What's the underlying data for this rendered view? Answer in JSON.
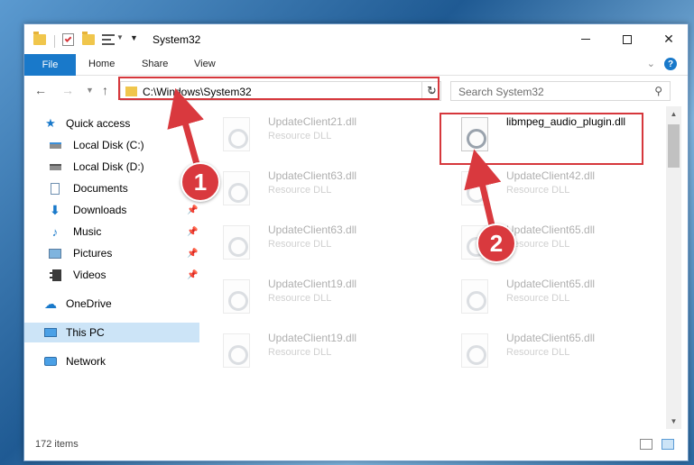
{
  "window": {
    "title": "System32"
  },
  "ribbon": {
    "tabs": [
      "File",
      "Home",
      "Share",
      "View"
    ]
  },
  "address": {
    "path": "C:\\Windows\\System32",
    "search_placeholder": "Search System32"
  },
  "sidebar": {
    "items": [
      {
        "label": "Quick access",
        "icon": "star-icon"
      },
      {
        "label": "Local Disk (C:)",
        "icon": "drive-icon"
      },
      {
        "label": "Local Disk (D:)",
        "icon": "drive-icon"
      },
      {
        "label": "Documents",
        "icon": "documents-icon"
      },
      {
        "label": "Downloads",
        "icon": "download-icon"
      },
      {
        "label": "Music",
        "icon": "music-icon"
      },
      {
        "label": "Pictures",
        "icon": "pictures-icon"
      },
      {
        "label": "Videos",
        "icon": "videos-icon"
      },
      {
        "label": "OneDrive",
        "icon": "cloud-icon"
      },
      {
        "label": "This PC",
        "icon": "computer-icon"
      },
      {
        "label": "Network",
        "icon": "network-icon"
      }
    ]
  },
  "files": [
    {
      "name": "UpdateClient21.dll",
      "type": "Resource DLL"
    },
    {
      "name": "libmpeg_audio_plugin.dll",
      "type": ""
    },
    {
      "name": "UpdateClient63.dll",
      "type": "Resource DLL"
    },
    {
      "name": "UpdateClient42.dll",
      "type": "Resource DLL"
    },
    {
      "name": "UpdateClient63.dll",
      "type": "Resource DLL"
    },
    {
      "name": "UpdateClient65.dll",
      "type": "Resource DLL"
    },
    {
      "name": "UpdateClient19.dll",
      "type": "Resource DLL"
    },
    {
      "name": "UpdateClient65.dll",
      "type": "Resource DLL"
    },
    {
      "name": "UpdateClient19.dll",
      "type": "Resource DLL"
    },
    {
      "name": "UpdateClient65.dll",
      "type": "Resource DLL"
    }
  ],
  "status": {
    "items": "172 items"
  },
  "callouts": {
    "one": "1",
    "two": "2"
  },
  "colors": {
    "accent": "#1979ca",
    "highlight": "#d6373c",
    "selected": "#cce4f7"
  }
}
